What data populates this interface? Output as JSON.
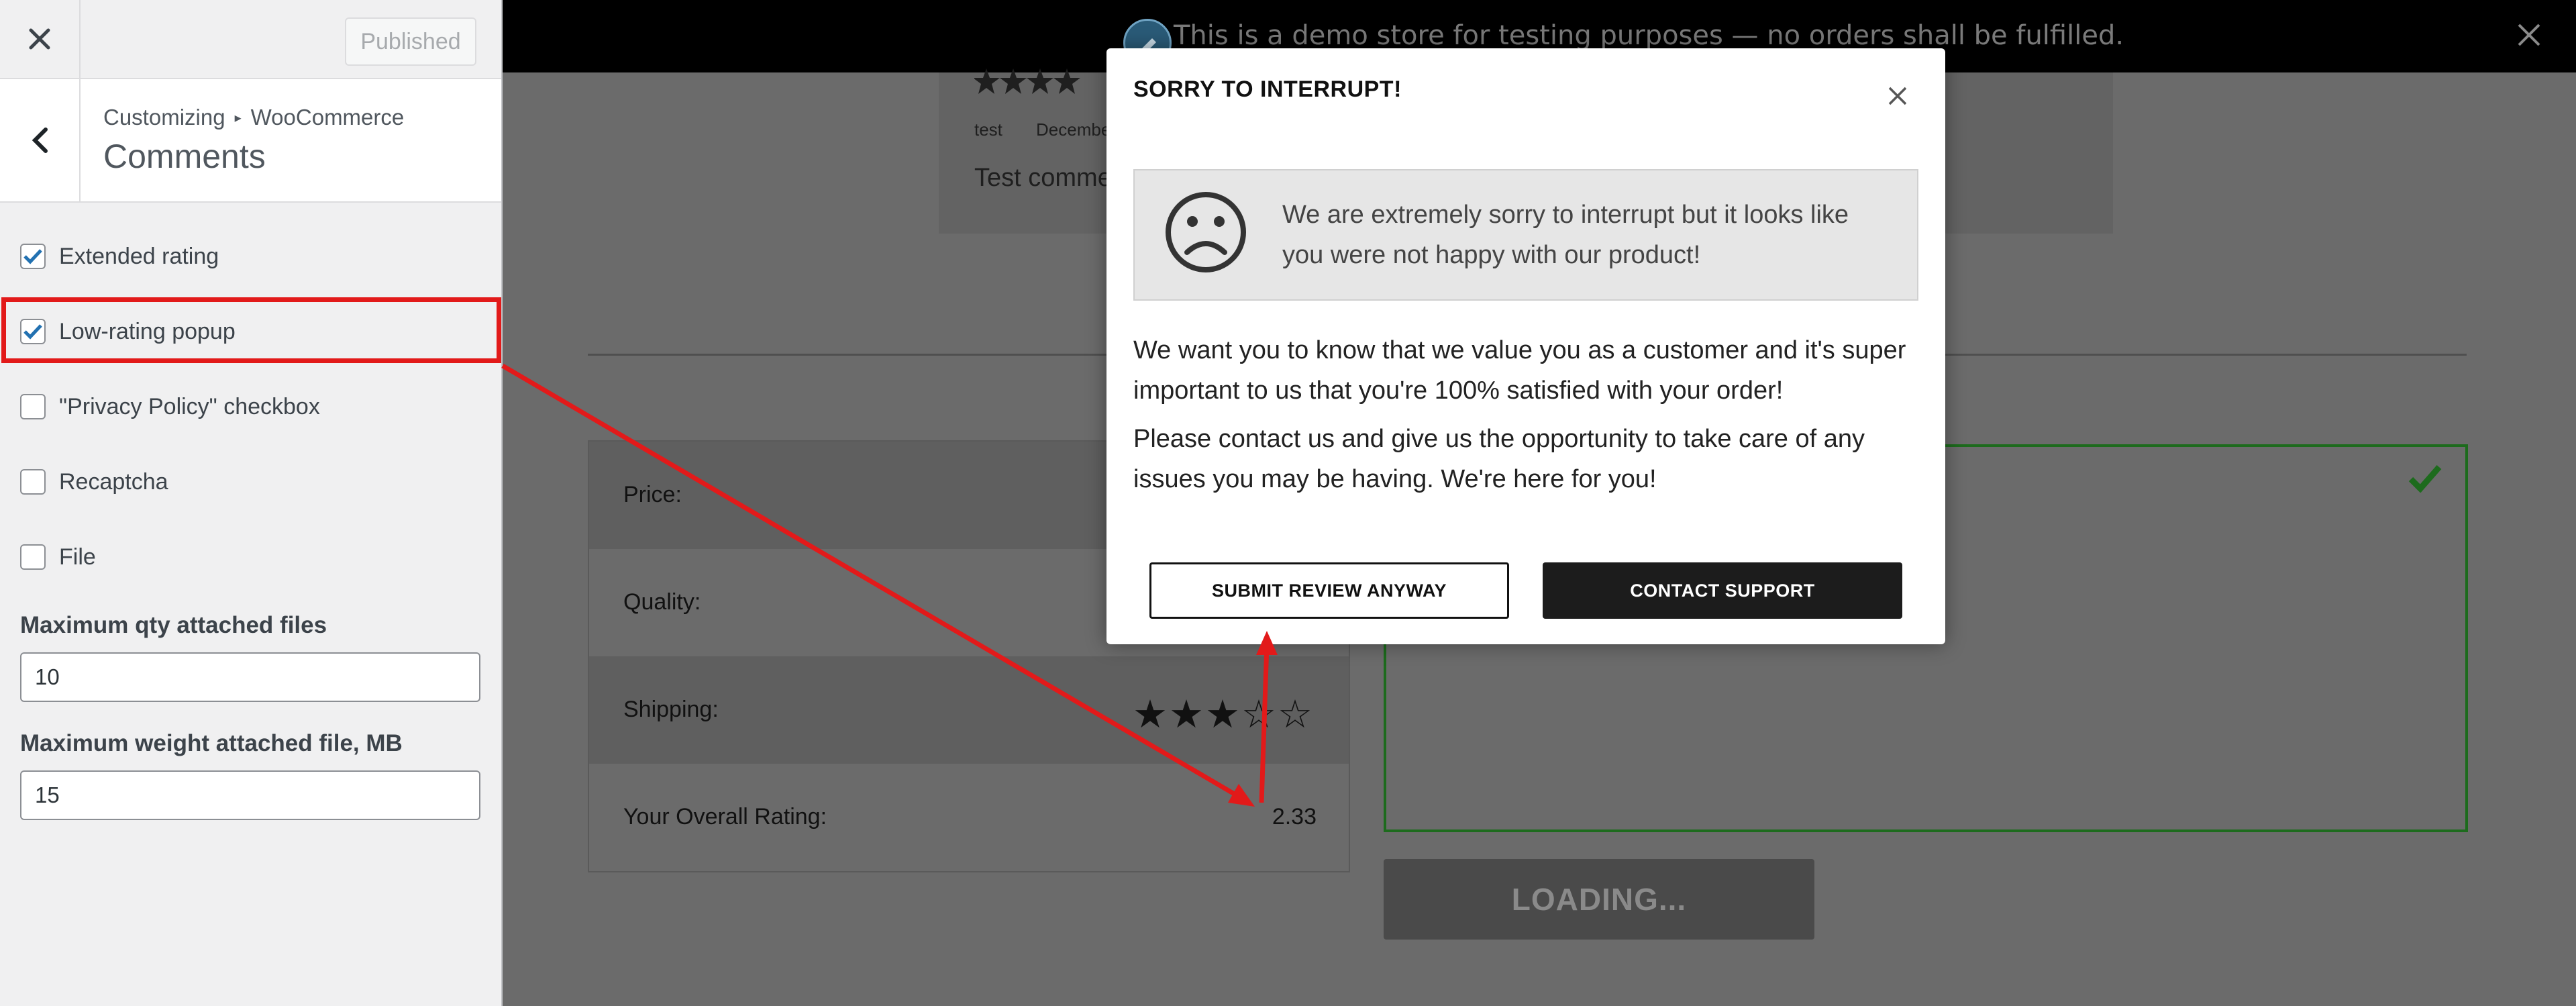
{
  "sidebar": {
    "close_label": "×",
    "published_label": "Published",
    "breadcrumb": {
      "root": "Customizing",
      "separator": "▸",
      "section": "WooCommerce"
    },
    "title": "Comments",
    "options": [
      {
        "label": "Extended rating",
        "checked": true
      },
      {
        "label": "Low-rating popup",
        "checked": true
      },
      {
        "label": "\"Privacy Policy\" checkbox",
        "checked": false
      },
      {
        "label": "Recaptcha",
        "checked": false
      },
      {
        "label": "File",
        "checked": false
      }
    ],
    "fields": [
      {
        "label": "Maximum qty attached files",
        "value": "10"
      },
      {
        "label": "Maximum weight attached file, MB",
        "value": "15"
      }
    ]
  },
  "preview": {
    "demo_notice": "This is a demo store for testing purposes — no orders shall be fulfilled.",
    "review": {
      "author": "test",
      "date": "December",
      "comment": "Test commen"
    },
    "ratings": [
      {
        "label": "Price:",
        "stars": ""
      },
      {
        "label": "Quality:",
        "stars": ""
      },
      {
        "label": "Shipping:",
        "stars": "★★★☆☆"
      }
    ],
    "overall": {
      "label": "Your Overall Rating:",
      "value": "2.33"
    },
    "loading_label": "LOADING..."
  },
  "popup": {
    "title": "SORRY TO INTERRUPT!",
    "warning": "We are extremely sorry to interrupt but it looks like you were not happy with our product!",
    "paragraph1": "We want you to know that we value you as a customer and it's super important to us that you're 100% satisfied with your order!",
    "paragraph2": "Please contact us and give us the opportunity to take care of any issues you may be having. We're here for you!",
    "submit_label": "SUBMIT REVIEW ANYWAY",
    "contact_label": "CONTACT SUPPORT"
  },
  "colors": {
    "annotation_red": "#e21a1a",
    "overlay_gray": "#6b6b6b",
    "success_green": "#1d6b1d",
    "checkbox_blue": "#2271b1"
  }
}
